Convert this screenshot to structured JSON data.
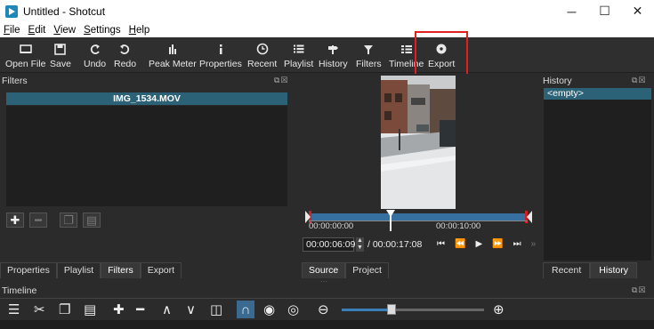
{
  "window": {
    "title": "Untitled - Shotcut",
    "controls": [
      "─",
      "☐",
      "✕"
    ]
  },
  "menu": [
    {
      "label": "File",
      "mnemonic": "F",
      "rest": "ile"
    },
    {
      "label": "Edit",
      "mnemonic": "E",
      "rest": "dit"
    },
    {
      "label": "View",
      "mnemonic": "V",
      "rest": "iew"
    },
    {
      "label": "Settings",
      "mnemonic": "S",
      "rest": "ettings"
    },
    {
      "label": "Help",
      "mnemonic": "H",
      "rest": "elp"
    }
  ],
  "toolbar": {
    "open_file": "Open File",
    "save": "Save",
    "undo": "Undo",
    "redo": "Redo",
    "peak_meter": "Peak Meter",
    "properties": "Properties",
    "recent": "Recent",
    "playlist": "Playlist",
    "history": "History",
    "filters": "Filters",
    "timeline": "Timeline",
    "export": "Export"
  },
  "filters_panel": {
    "title": "Filters",
    "clip_name": "IMG_1534.MOV",
    "tabs": [
      "Properties",
      "Playlist",
      "Filters",
      "Export"
    ],
    "active_tab": "Filters"
  },
  "player": {
    "ticks": [
      "00:00:00:00",
      "00:00:10:00"
    ],
    "current_timecode": "00:00:06:09",
    "total_duration": "/ 00:00:17:08",
    "tabs": [
      "Source",
      "Project"
    ],
    "active_tab": "Source",
    "playhead_fraction": 0.37
  },
  "history_panel": {
    "title": "History",
    "items": [
      "<empty>"
    ],
    "tabs": [
      "Recent",
      "History"
    ],
    "active_tab": "History"
  },
  "timeline": {
    "title": "Timeline",
    "zoom_fraction": 0.35
  },
  "colors": {
    "accent": "#2c6278",
    "scrub_bar": "#3570a0",
    "highlight": "#e02020"
  }
}
